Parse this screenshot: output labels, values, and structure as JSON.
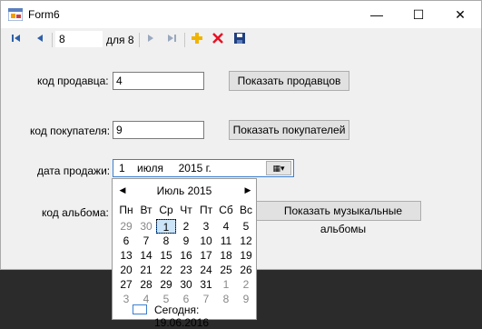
{
  "window": {
    "title": "Form6",
    "minimize": "—",
    "maximize": "☐",
    "close": "✕"
  },
  "toolbar": {
    "position_value": "8",
    "count_label": "для 8",
    "icons": [
      "move-first-icon",
      "move-previous-icon",
      "move-next-icon",
      "move-last-icon",
      "add-icon",
      "delete-icon",
      "save-icon"
    ]
  },
  "fields": {
    "seller_label": "код продавца:",
    "seller_value": "4",
    "show_sellers_button": "Показать продавцов",
    "buyer_label": "код покупателя:",
    "buyer_value": "9",
    "show_buyers_button": "Показать покупателей",
    "sale_date_label": "дата продажи:",
    "sale_date_value": "1    июля     2015 г.",
    "album_label": "код альбома:",
    "show_albums_button": "Показать музыкальные альбомы"
  },
  "calendar": {
    "month_title": "Июль 2015",
    "prev": "◀",
    "next": "▶",
    "weekdays": [
      "Пн",
      "Вт",
      "Ср",
      "Чт",
      "Пт",
      "Сб",
      "Вс"
    ],
    "weeks": [
      [
        "29",
        "30",
        "1",
        "2",
        "3",
        "4",
        "5"
      ],
      [
        "6",
        "7",
        "8",
        "9",
        "10",
        "11",
        "12"
      ],
      [
        "13",
        "14",
        "15",
        "16",
        "17",
        "18",
        "19"
      ],
      [
        "20",
        "21",
        "22",
        "23",
        "24",
        "25",
        "26"
      ],
      [
        "27",
        "28",
        "29",
        "30",
        "31",
        "1",
        "2"
      ],
      [
        "3",
        "4",
        "5",
        "6",
        "7",
        "8",
        "9"
      ]
    ],
    "today_text": "Сегодня: 19.06.2016"
  },
  "colors": {
    "accent": "#3b7fd0",
    "delete": "#e81123",
    "add": "#f0b400",
    "nav": "#2f5fa8"
  }
}
